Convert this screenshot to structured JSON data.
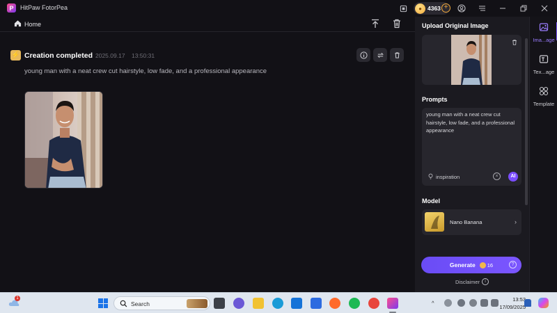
{
  "app": {
    "title": "HitPaw FotorPea",
    "coins": "4363"
  },
  "nav": {
    "home_label": "Home"
  },
  "result": {
    "status": "Creation completed",
    "timestamp": "2025.09.17    13:50:31",
    "prompt_echo": "young man with a neat crew cut hairstyle, low fade, and a professional appearance"
  },
  "panel": {
    "upload_title": "Upload Original Image",
    "prompts_title": "Prompts",
    "prompt_value": "young man with a neat crew cut hairstyle, low fade, and a professional appearance",
    "inspiration_label": "inspiration",
    "ai_label": "AI",
    "model_title": "Model",
    "model_name": "Nano Banana",
    "generate_label": "Generate",
    "generate_cost": "16",
    "disclaimer_label": "Disclaimer"
  },
  "rail": {
    "items": [
      {
        "label": "Ima...age",
        "icon": "image-icon",
        "active": true
      },
      {
        "label": "Tex...age",
        "icon": "text-image-icon",
        "active": false
      },
      {
        "label": "Template",
        "icon": "template-icon",
        "active": false
      }
    ]
  },
  "taskbar": {
    "search_placeholder": "Search",
    "weather_badge": "1",
    "time": "13:53",
    "date": "17/09/2025"
  },
  "colors": {
    "accent": "#7b56ff",
    "background": "#121116",
    "panel": "#1b1a20",
    "coin": "#f2a93b"
  }
}
